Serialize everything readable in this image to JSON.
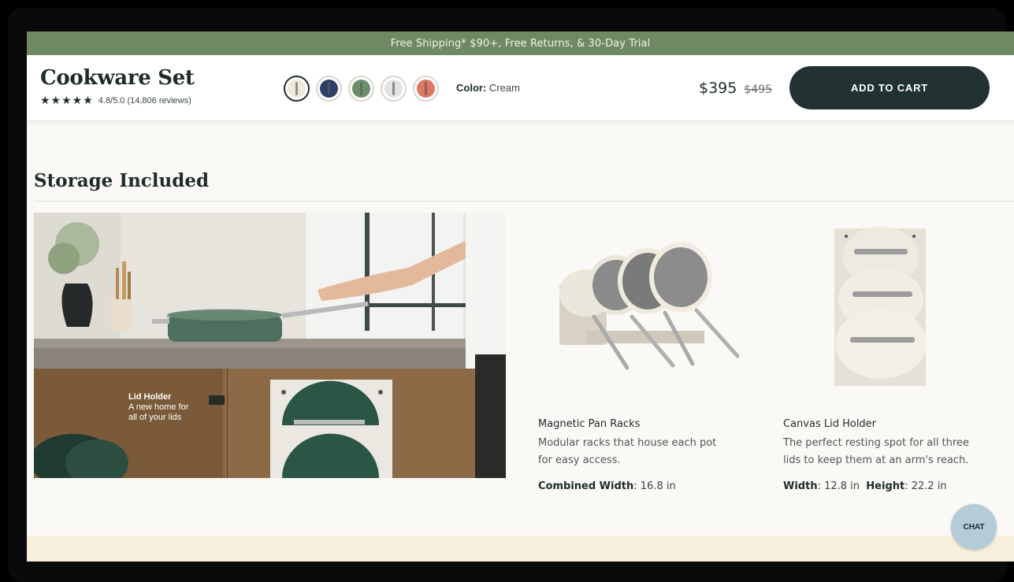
{
  "promo": {
    "text": "Free Shipping* $90+, Free Returns, & 30-Day Trial"
  },
  "product": {
    "title": "Cookware Set",
    "stars": "★★★★★",
    "rating_text": "4.8/5.0 (14,806 reviews)",
    "color_label": "Color:",
    "color_value": "Cream",
    "price": "$395",
    "price_old": "$495",
    "cta": "ADD TO CART",
    "swatches": [
      {
        "name": "Cream",
        "color": "#efe9da"
      },
      {
        "name": "Navy",
        "color": "#2d3f66"
      },
      {
        "name": "Sage",
        "color": "#6a8f6b"
      },
      {
        "name": "Gray",
        "color": "#e3e3e3"
      },
      {
        "name": "Terracotta",
        "color": "#de7763"
      }
    ]
  },
  "section": {
    "title": "Storage Included",
    "hero_caption_title": "Lid Holder",
    "hero_caption_line1": "A new home for",
    "hero_caption_line2": "all of your lids"
  },
  "products": [
    {
      "name": "Magnetic Pan Racks",
      "desc_line1": "Modular racks that house each pot",
      "desc_line2": "for easy access.",
      "dim1_label": "Combined Width",
      "dim1_value": ": 16.8 in"
    },
    {
      "name": "Canvas Lid Holder",
      "desc_line1": "The perfect resting spot for all three",
      "desc_line2": "lids to keep them at an arm's reach.",
      "dim1_label": "Width",
      "dim1_value": ": 12.8 in",
      "dim2_label": "Height",
      "dim2_value": ": 22.2 in"
    }
  ],
  "chat": {
    "label": "CHAT"
  },
  "colors": {
    "brand_green": "#6f8a62",
    "button_dark": "#223233",
    "band": "#f6efdc"
  }
}
